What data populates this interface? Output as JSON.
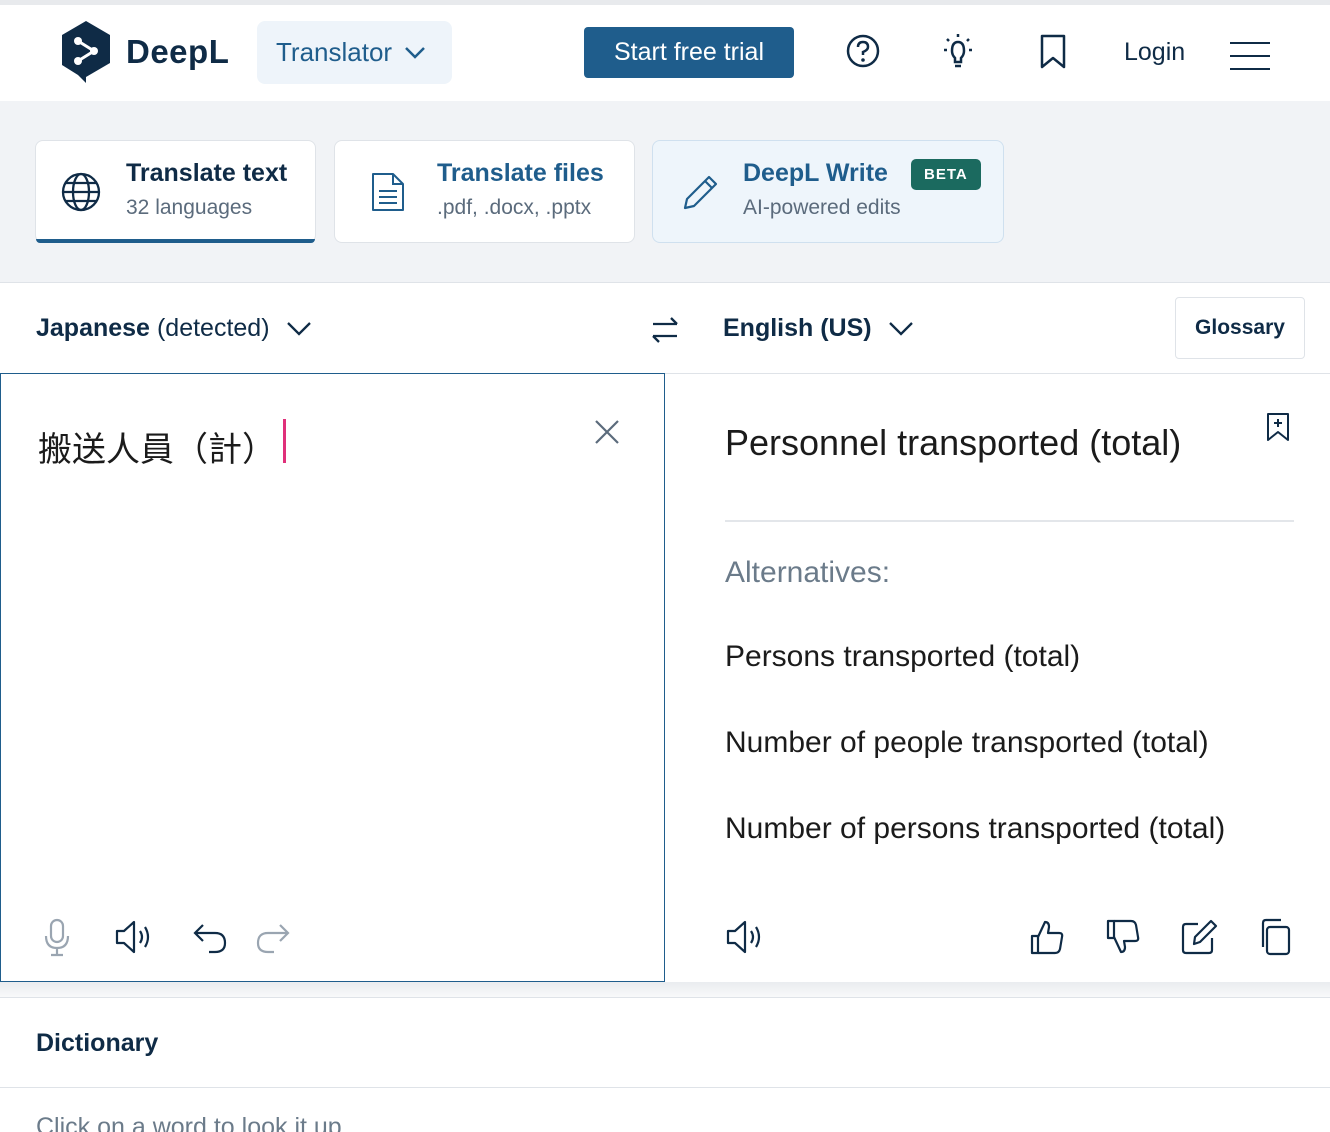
{
  "header": {
    "brand": "DeepL",
    "translator_label": "Translator",
    "trial_label": "Start free trial",
    "login_label": "Login",
    "icons": [
      "help-icon",
      "lightbulb-icon",
      "bookmark-icon",
      "menu-icon"
    ]
  },
  "modes": [
    {
      "title": "Translate text",
      "subtitle": "32 languages",
      "icon": "globe-icon",
      "active": true
    },
    {
      "title": "Translate files",
      "subtitle": ".pdf, .docx, .pptx",
      "icon": "document-icon"
    },
    {
      "title": "DeepL Write",
      "subtitle": "AI-powered edits",
      "icon": "pencil-icon",
      "badge": "BETA"
    }
  ],
  "languages": {
    "source_name": "Japanese",
    "source_detected": "(detected)",
    "target_name": "English (US)",
    "glossary_label": "Glossary"
  },
  "source": {
    "text": "搬送人員（計）"
  },
  "target": {
    "text": "Personnel transported (total)",
    "alternatives_label": "Alternatives:",
    "alternatives": [
      "Persons transported (total)",
      "Number of people transported (total)",
      "Number of persons transported (total)"
    ]
  },
  "dictionary": {
    "title": "Dictionary",
    "hint": "Click on a word to look it up."
  },
  "colors": {
    "brand": "#0f2b46",
    "accent": "#1f5d8c",
    "caret": "#e0307a",
    "beta_badge": "#1b6a5f"
  }
}
